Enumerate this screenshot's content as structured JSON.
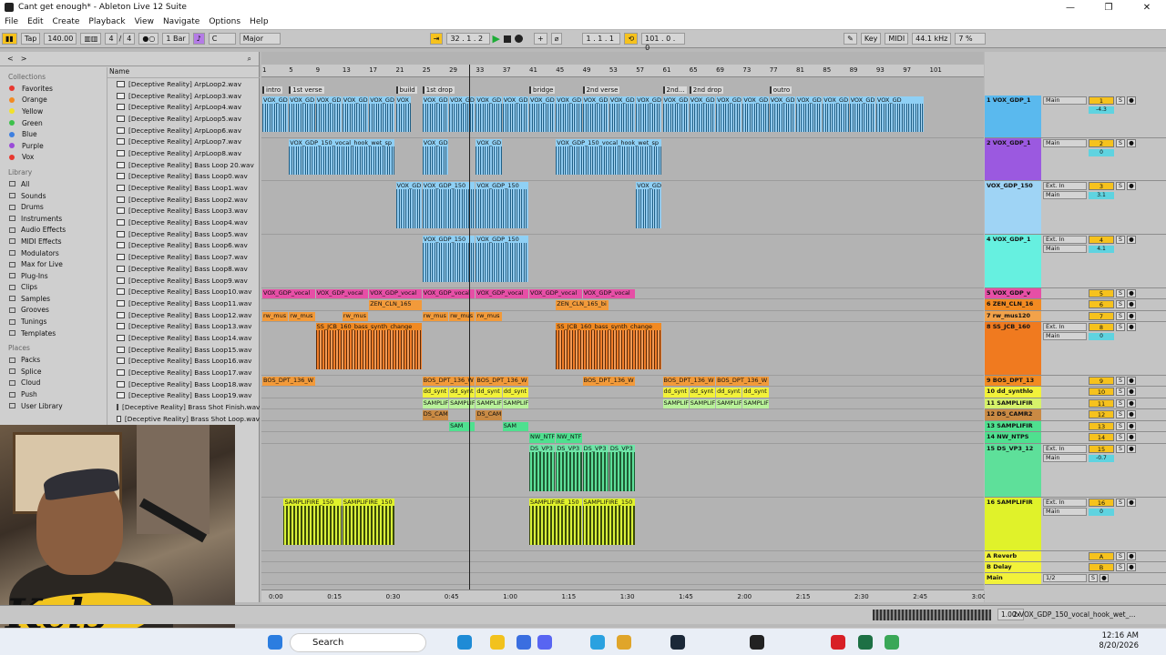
{
  "window": {
    "title": "Cant get enough* - Ableton Live 12 Suite"
  },
  "menu": [
    "File",
    "Edit",
    "Create",
    "Playback",
    "View",
    "Navigate",
    "Options",
    "Help"
  ],
  "transport": {
    "tap": "Tap",
    "tempo": "140.00",
    "sig_num": "4",
    "sig_den": "4",
    "quant": "1 Bar",
    "key": "C",
    "scale": "Major",
    "position": "32 .  1 .  2",
    "loop_start": "1 .  1 .  1",
    "loop_len": "101 .  0 .  0",
    "key_btn": "Key",
    "midi_btn": "MIDI",
    "sample_rate": "44.1 kHz",
    "cpu": "7 %"
  },
  "browser": {
    "collections_label": "Collections",
    "collections": [
      {
        "label": "Favorites",
        "color": "#e8382f"
      },
      {
        "label": "Orange",
        "color": "#f28a22"
      },
      {
        "label": "Yellow",
        "color": "#f2e12a"
      },
      {
        "label": "Green",
        "color": "#3cc04b"
      },
      {
        "label": "Blue",
        "color": "#3d7fe0"
      },
      {
        "label": "Purple",
        "color": "#9a4bd8"
      },
      {
        "label": "Vox",
        "color": "#e8382f"
      }
    ],
    "library_label": "Library",
    "library": [
      "All",
      "Sounds",
      "Drums",
      "Instruments",
      "Audio Effects",
      "MIDI Effects",
      "Modulators",
      "Max for Live",
      "Plug-Ins",
      "Clips",
      "Samples",
      "Grooves",
      "Tunings",
      "Templates"
    ],
    "places_label": "Places",
    "places": [
      "Packs",
      "Splice",
      "Cloud",
      "Push",
      "User Library"
    ],
    "column_header": "Name",
    "files": [
      "[Deceptive Reality] ArpLoop2.wav",
      "[Deceptive Reality] ArpLoop3.wav",
      "[Deceptive Reality] ArpLoop4.wav",
      "[Deceptive Reality] ArpLoop5.wav",
      "[Deceptive Reality] ArpLoop6.wav",
      "[Deceptive Reality] ArpLoop7.wav",
      "[Deceptive Reality] ArpLoop8.wav",
      "[Deceptive Reality] Bass Loop 20.wav",
      "[Deceptive Reality] Bass Loop0.wav",
      "[Deceptive Reality] Bass Loop1.wav",
      "[Deceptive Reality] Bass Loop2.wav",
      "[Deceptive Reality] Bass Loop3.wav",
      "[Deceptive Reality] Bass Loop4.wav",
      "[Deceptive Reality] Bass Loop5.wav",
      "[Deceptive Reality] Bass Loop6.wav",
      "[Deceptive Reality] Bass Loop7.wav",
      "[Deceptive Reality] Bass Loop8.wav",
      "[Deceptive Reality] Bass Loop9.wav",
      "[Deceptive Reality] Bass Loop10.wav",
      "[Deceptive Reality] Bass Loop11.wav",
      "[Deceptive Reality] Bass Loop12.wav",
      "[Deceptive Reality] Bass Loop13.wav",
      "[Deceptive Reality] Bass Loop14.wav",
      "[Deceptive Reality] Bass Loop15.wav",
      "[Deceptive Reality] Bass Loop16.wav",
      "[Deceptive Reality] Bass Loop17.wav",
      "[Deceptive Reality] Bass Loop18.wav",
      "[Deceptive Reality] Bass Loop19.wav",
      "[Deceptive Reality] Brass Shot Finish.wav",
      "[Deceptive Reality] Brass Shot Loop.wav"
    ]
  },
  "overlay": {
    "logo_text": "Kels"
  },
  "arrangement": {
    "bars": [
      "1",
      "5",
      "9",
      "13",
      "17",
      "21",
      "25",
      "29",
      "33",
      "37",
      "41",
      "45",
      "49",
      "53",
      "57",
      "61",
      "65",
      "69",
      "73",
      "77",
      "81",
      "85",
      "89",
      "93",
      "97",
      "101"
    ],
    "sections": [
      {
        "label": "intro",
        "col": 0
      },
      {
        "label": "1st verse",
        "col": 1
      },
      {
        "label": "build",
        "col": 5
      },
      {
        "label": "1st drop",
        "col": 6
      },
      {
        "label": "bridge",
        "col": 10
      },
      {
        "label": "2nd verse",
        "col": 12
      },
      {
        "label": "2nd...",
        "col": 15
      },
      {
        "label": "2nd drop",
        "col": 16
      },
      {
        "label": "outro",
        "col": 19
      }
    ],
    "time_marks": [
      "0:00",
      "0:15",
      "0:30",
      "0:45",
      "1:00",
      "1:15",
      "1:30",
      "1:45",
      "2:00",
      "2:15",
      "2:30",
      "2:45",
      "3:00"
    ],
    "lane_clips": [
      {
        "lane": 0,
        "color": "blue",
        "clips": [
          [
            "VOX_GD",
            0,
            1
          ],
          [
            "VOX_GD",
            1,
            2
          ],
          [
            "VOX_GD",
            2,
            3
          ],
          [
            "VOX_GD",
            3,
            4
          ],
          [
            "VOX_GD",
            4,
            5
          ],
          [
            "VOX_G",
            5,
            5.6
          ],
          [
            "VOX_GD",
            6,
            7
          ],
          [
            "VOX_GD",
            7,
            8
          ],
          [
            "VOX_GD",
            8,
            9
          ],
          [
            "VOX_GD",
            9,
            10
          ],
          [
            "VOX_GD",
            10,
            11
          ],
          [
            "VOX_GD",
            11,
            12
          ],
          [
            "VOX_GD",
            12,
            13
          ],
          [
            "VOX_GD",
            13,
            14
          ],
          [
            "VOX_GD",
            14,
            15
          ],
          [
            "VOX_GD",
            15,
            16
          ],
          [
            "VOX_GD",
            16,
            17
          ],
          [
            "VOX_GD",
            17,
            18
          ],
          [
            "VOX_GD",
            18,
            19
          ],
          [
            "VOX_GD",
            19,
            20
          ],
          [
            "VOX_GD",
            20,
            21
          ],
          [
            "VOX_GD",
            21,
            22
          ],
          [
            "VOX_GD",
            22,
            23
          ],
          [
            "VOX_GD",
            23,
            24.8
          ]
        ]
      },
      {
        "lane": 1,
        "color": "blue",
        "clips": [
          [
            "VOX_GDP_150_vocal_hook_wet_sp",
            1,
            5
          ],
          [
            "VOX_GD",
            6,
            7
          ],
          [
            "VOX_GD",
            8,
            9
          ],
          [
            "VOX_GDP_150_vocal_hook_wet_sp",
            11,
            15
          ]
        ]
      },
      {
        "lane": 2,
        "color": "blue",
        "clips": [
          [
            "VOX_GD",
            5,
            6
          ],
          [
            "VOX_GDP_150",
            6,
            8
          ],
          [
            "VOX_GDP_150",
            8,
            10
          ],
          [
            "VOX_GD",
            14,
            15
          ]
        ]
      },
      {
        "lane": 3,
        "color": "blue",
        "clips": [
          [
            "VOX_GDP_150",
            6,
            8
          ],
          [
            "VOX_GDP_150",
            8,
            10
          ]
        ]
      },
      {
        "lane": 4,
        "color": "pink",
        "clips": [
          [
            "VOX_GDP_vocal",
            0,
            2
          ],
          [
            "VOX_GDP_vocal",
            2,
            4
          ],
          [
            "VOX_GDP_vocal",
            4,
            6
          ],
          [
            "VOX_GDP_vocal",
            6,
            8
          ],
          [
            "VOX_GDP_vocal",
            8,
            10
          ],
          [
            "VOX_GDP_vocal",
            10,
            12
          ],
          [
            "VOX_GDP_vocal",
            12,
            14
          ]
        ]
      },
      {
        "lane": 5,
        "color": "orange",
        "clips": [
          [
            "ZEN_CLN_165",
            4,
            6
          ],
          [
            "ZEN_CLN_165_bi",
            11,
            13
          ]
        ]
      },
      {
        "lane": 6,
        "color": "orange",
        "clips": [
          [
            "rw_mus",
            0,
            1
          ],
          [
            "rw_mus",
            1,
            2
          ],
          [
            "rw_mus",
            3,
            4
          ],
          [
            "rw_mus",
            6,
            7
          ],
          [
            "rw_mus",
            7,
            8
          ],
          [
            "rw_mus",
            8,
            9
          ]
        ]
      },
      {
        "lane": 7,
        "color": "orangew",
        "clips": [
          [
            "SS_JCB_160_bass_synth_change",
            2,
            6
          ],
          [
            "SS_JCB_160_bass_synth_change",
            11,
            15
          ]
        ]
      },
      {
        "lane": 8,
        "color": "orange",
        "clips": [
          [
            "BOS_DPT_136_W",
            0,
            2
          ],
          [
            "BOS_DPT_136_W",
            6,
            8
          ],
          [
            "BOS_DPT_136_W",
            8,
            10
          ],
          [
            "BOS_DPT_136_W",
            12,
            14
          ],
          [
            "BOS_DPT_136_W",
            15,
            17
          ],
          [
            "BOS_DPT_136_W",
            17,
            19
          ]
        ]
      },
      {
        "lane": 9,
        "color": "yellow",
        "clips": [
          [
            "dd_synt",
            6,
            7
          ],
          [
            "dd_synt",
            7,
            8
          ],
          [
            "dd_synt",
            8,
            9
          ],
          [
            "dd_synt",
            9,
            10
          ],
          [
            "dd_synt",
            15,
            16
          ],
          [
            "dd_synt",
            16,
            17
          ],
          [
            "dd_synt",
            17,
            18
          ],
          [
            "dd_synt",
            18,
            19
          ]
        ]
      },
      {
        "lane": 10,
        "color": "lgreen",
        "clips": [
          [
            "SAMPLIF",
            6,
            7
          ],
          [
            "SAMPLIF",
            7,
            8
          ],
          [
            "SAMPLIF",
            8,
            9
          ],
          [
            "SAMPLIF",
            9,
            10
          ],
          [
            "SAMPLIF",
            15,
            16
          ],
          [
            "SAMPLIF",
            16,
            17
          ],
          [
            "SAMPLIF",
            17,
            18
          ],
          [
            "SAMPLIF",
            18,
            19
          ]
        ]
      },
      {
        "lane": 11,
        "color": "brown",
        "clips": [
          [
            "DS_CAM",
            6,
            7
          ],
          [
            "DS_CAM",
            8,
            9
          ]
        ]
      },
      {
        "lane": 12,
        "color": "green",
        "clips": [
          [
            "SAM",
            7,
            8
          ],
          [
            "SAM",
            9,
            10
          ]
        ]
      },
      {
        "lane": 13,
        "color": "green",
        "clips": [
          [
            "NW_NTF",
            10,
            11
          ],
          [
            "NW_NTF",
            11,
            12
          ]
        ]
      },
      {
        "lane": 14,
        "color": "greenw",
        "clips": [
          [
            "DS_VP3",
            10,
            11
          ],
          [
            "DS_VP3",
            11,
            12
          ],
          [
            "DS_VP3",
            12,
            13
          ],
          [
            "DS_VP3",
            13,
            14
          ]
        ]
      },
      {
        "lane": 15,
        "color": "limew",
        "clips": [
          [
            "SAMPLIFIRE_150",
            0.8,
            3
          ],
          [
            "SAMPLIFIRE_150",
            3,
            5
          ],
          [
            "SAMPLIFIRE_150",
            10,
            12
          ],
          [
            "SAMPLIFIRE_150",
            12,
            14
          ]
        ]
      }
    ]
  },
  "tracks": [
    {
      "name": "1 VOX_GDP_1",
      "color": "#5ab9ee",
      "num": "1",
      "input": "",
      "route": "Main",
      "vol": "-4.3",
      "h": 47
    },
    {
      "name": "2 VOX_GDP_1",
      "color": "#9b59e0",
      "num": "2",
      "input": "",
      "route": "Main",
      "vol": "0",
      "h": 47
    },
    {
      "name": "VOX_GDP_150",
      "color": "#9fd4f5",
      "num": "3",
      "input": "Ext. In",
      "route": "Main",
      "vol": "3.1",
      "h": 59
    },
    {
      "name": "4 VOX_GDP_1",
      "color": "#66f0e0",
      "num": "4",
      "input": "Ext. In",
      "route": "Main",
      "vol": "4.1",
      "h": 59
    },
    {
      "name": "5 VOX_GDP_v",
      "color": "#e64fa6",
      "num": "5",
      "input": "",
      "route": "",
      "vol": "",
      "h": 12
    },
    {
      "name": "6 ZEN_CLN_16",
      "color": "#f28a22",
      "num": "6",
      "input": "",
      "route": "",
      "vol": "",
      "h": 13
    },
    {
      "name": "7 rw_mus120",
      "color": "#f2a24a",
      "num": "7",
      "input": "",
      "route": "",
      "vol": "",
      "h": 12
    },
    {
      "name": "8 SS_JCB_160",
      "color": "#f07a1f",
      "num": "8",
      "input": "Ext. In",
      "route": "Main",
      "vol": "0",
      "h": 59
    },
    {
      "name": "9 BOS_DPT_13",
      "color": "#f28a22",
      "num": "9",
      "input": "",
      "route": "",
      "vol": "",
      "h": 12
    },
    {
      "name": "10 dd_synthlo",
      "color": "#f2f23a",
      "num": "10",
      "input": "",
      "route": "",
      "vol": "",
      "h": 13
    },
    {
      "name": "11 SAMPLIFIR",
      "color": "#d6f26a",
      "num": "11",
      "input": "",
      "route": "",
      "vol": "",
      "h": 12
    },
    {
      "name": "12 DS_CAMR2",
      "color": "#c98a44",
      "num": "12",
      "input": "",
      "route": "",
      "vol": "",
      "h": 13
    },
    {
      "name": "13 SAMPLIFIR",
      "color": "#4fe08f",
      "num": "13",
      "input": "",
      "route": "",
      "vol": "",
      "h": 12
    },
    {
      "name": "14 NW_NTPS",
      "color": "#4fe08f",
      "num": "14",
      "input": "",
      "route": "",
      "vol": "",
      "h": 13
    },
    {
      "name": "15 DS_VP3_12",
      "color": "#5ee09a",
      "num": "15",
      "input": "Ext. In",
      "route": "Main",
      "vol": "-0.7",
      "h": 59
    },
    {
      "name": "16 SAMPLIFIR",
      "color": "#e0f22a",
      "num": "16",
      "input": "Ext. In",
      "route": "Main",
      "vol": "0",
      "h": 59
    },
    {
      "name": "A Reverb",
      "color": "#f2f23a",
      "num": "A",
      "input": "",
      "route": "",
      "vol": "",
      "h": 12
    },
    {
      "name": "B Delay",
      "color": "#f2f23a",
      "num": "B",
      "input": "",
      "route": "",
      "vol": "",
      "h": 12
    },
    {
      "name": "Main",
      "color": "#f2f23a",
      "num": "",
      "input": "",
      "route": "1/2",
      "vol": "",
      "h": 13
    }
  ],
  "status": {
    "clip_name": "2-VOX_GDP_150_vocal_hook_wet_...",
    "zoom": "1.00x"
  },
  "taskbar": {
    "search_placeholder": "Search",
    "time": "12:16 AM",
    "date": "8/20/2026"
  }
}
